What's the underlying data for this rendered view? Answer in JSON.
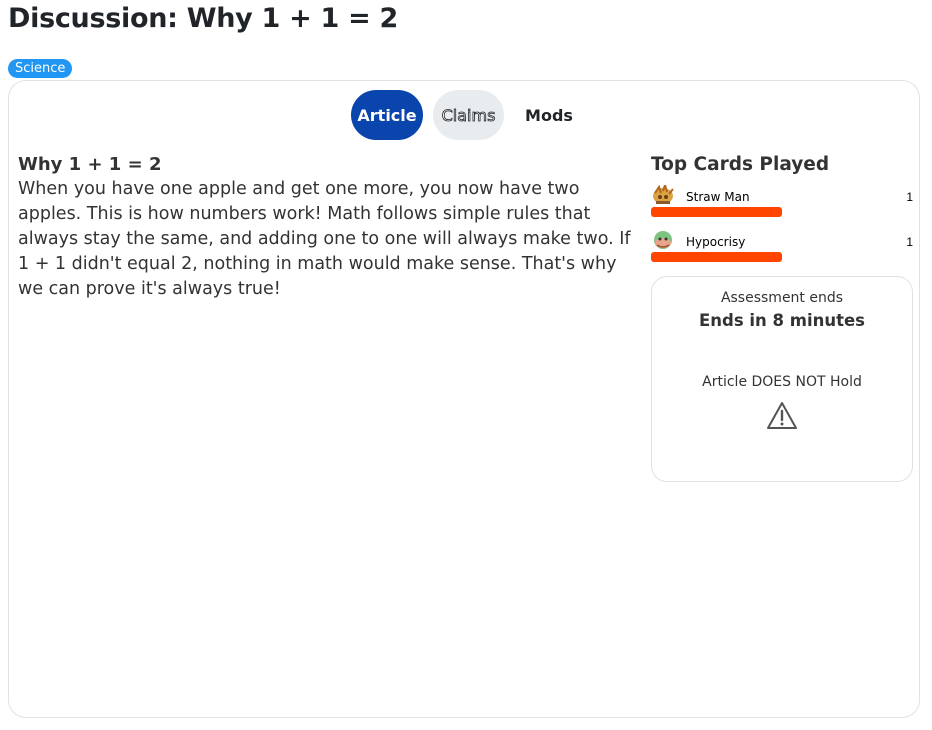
{
  "page": {
    "title": "Discussion: Why 1 + 1 = 2",
    "category": "Science"
  },
  "tabs": [
    {
      "label": "Article",
      "active": true
    },
    {
      "label": "Claims",
      "active": false
    },
    {
      "label": "Mods",
      "active": false
    }
  ],
  "article": {
    "title": "Why 1 + 1 = 2",
    "body": "When you have one apple and get one more, you now have two apples. This is how numbers work! Math follows simple rules that always stay the same, and adding one to one will always make two. If 1 + 1 didn't equal 2, nothing in math would make sense. That's why we can prove it's always true!"
  },
  "sidebar": {
    "heading": "Top Cards Played",
    "cards": [
      {
        "name": "Straw Man",
        "count": "1",
        "icon": "straw-man-icon",
        "bar_fraction": 1.0
      },
      {
        "name": "Hypocrisy",
        "count": "1",
        "icon": "hypocrisy-icon",
        "bar_fraction": 1.0
      }
    ],
    "bar_color": "#ff4500",
    "assessment": {
      "label": "Assessment ends",
      "time": "Ends in 8 minutes",
      "result": "Article DOES NOT Hold",
      "icon": "warning-icon"
    }
  },
  "colors": {
    "badge": "#2196f3",
    "active_tab": "#0a44ad",
    "inactive_tab": "#e9ecef"
  }
}
